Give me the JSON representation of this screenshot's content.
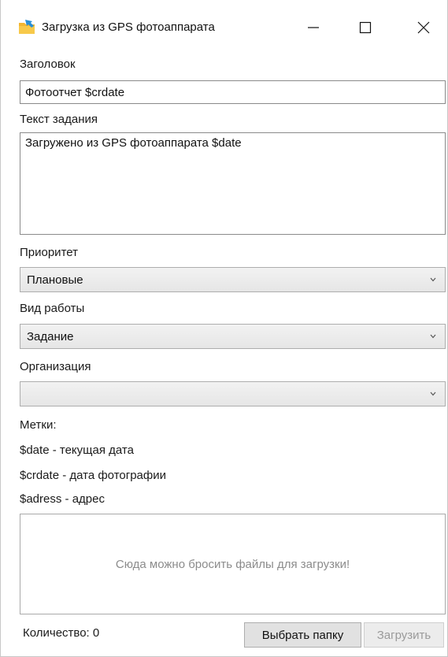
{
  "window": {
    "title": "Загрузка из GPS фотоаппарата",
    "icon": "folder-arrow-icon",
    "controls": [
      "minimize-icon",
      "maximize-icon",
      "close-icon"
    ]
  },
  "form": {
    "title_label": "Заголовок",
    "title_value": "Фотоотчет $crdate",
    "task_text_label": "Текст задания",
    "task_text_value": "Загружено из GPS фотоаппарата $date",
    "priority_label": "Приоритет",
    "priority_value": "Плановые",
    "work_type_label": "Вид работы",
    "work_type_value": "Задание",
    "organization_label": "Организация",
    "organization_value": ""
  },
  "tags": {
    "heading": "Метки:",
    "items": [
      "$date - текущая дата",
      "$crdate - дата фотографии",
      "$adress - адрес"
    ]
  },
  "dropzone": {
    "text": "Сюда можно бросить файлы для загрузки!"
  },
  "footer": {
    "count_label": "Количество: 0",
    "choose_folder": "Выбрать папку",
    "upload": "Загрузить"
  },
  "colors": {
    "accent_folder": "#f2b632",
    "accent_arrow": "#2a8fd6",
    "disabled_text": "#9a9a9a",
    "placeholder_text": "#8c8c8c"
  }
}
